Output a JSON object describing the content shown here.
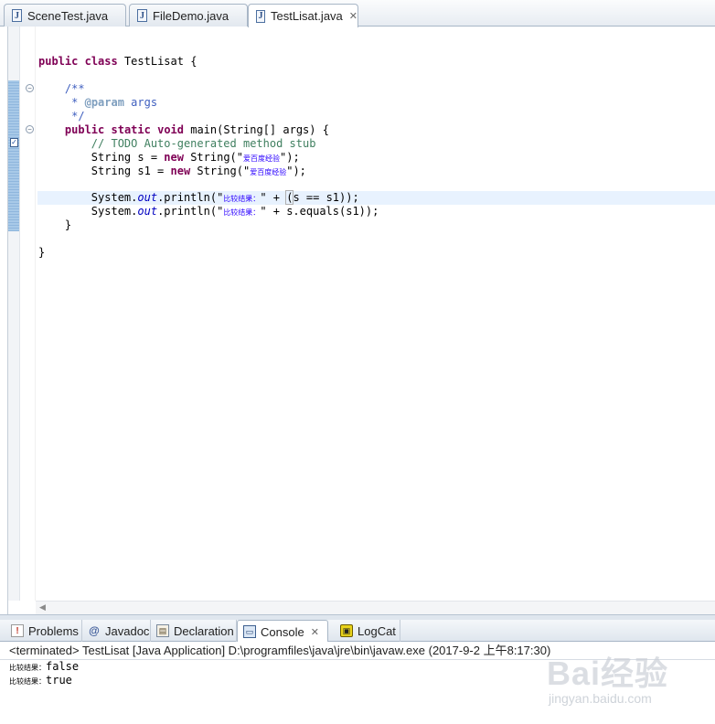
{
  "editor_tabs": [
    {
      "label": "SceneTest.java",
      "icon": "java-file-icon"
    },
    {
      "label": "FileDemo.java",
      "icon": "java-file-icon"
    },
    {
      "label": "TestLisat.java",
      "icon": "java-file-icon",
      "active": true,
      "close": "✕"
    }
  ],
  "code": {
    "l1_kw1": "public",
    "l1_kw2": "class",
    "l1_rest": "TestLisat {",
    "l2": "/**",
    "l3_star": " * ",
    "l3_tag": "@param",
    "l3_rest": " args",
    "l4": " */",
    "l5_kw1": "public",
    "l5_kw2": "static",
    "l5_kw3": "void",
    "l5_rest": "main(String[] args) {",
    "l6": "// TODO Auto-generated method stub",
    "l7_a": "String s = ",
    "l7_kw": "new",
    "l7_b": " String(\"",
    "l7_str": "爱百度经验",
    "l7_c": "\");",
    "l8_a": "String s1 = ",
    "l8_kw": "new",
    "l8_b": " String(\"",
    "l8_str": "爱百度经验",
    "l8_c": "\");",
    "l9_a": "System.",
    "l9_out": "out",
    "l9_b": ".println(\"",
    "l9_str": "比较结果：",
    "l9_c": "\" + ",
    "l9_box": "(",
    "l9_d": "s == s1));",
    "l10_a": "System.",
    "l10_out": "out",
    "l10_b": ".println(\"",
    "l10_str": "比较结果：",
    "l10_c": "\" + s.equals(s1));",
    "l11": "}",
    "l12": "}"
  },
  "view_tabs": [
    {
      "label": "Problems",
      "icon": "problems-icon"
    },
    {
      "label": "Javadoc",
      "icon": "javadoc-icon"
    },
    {
      "label": "Declaration",
      "icon": "declaration-icon"
    },
    {
      "label": "Console",
      "icon": "console-icon",
      "active": true,
      "close": "✕"
    },
    {
      "label": "LogCat",
      "icon": "logcat-icon"
    }
  ],
  "console": {
    "description": "<terminated> TestLisat [Java Application] D:\\programfiles\\java\\jre\\bin\\javaw.exe (2017-9-2 上午8:17:30)",
    "out1_label": "比较结果：",
    "out1_value": "false",
    "out2_label": "比较结果：",
    "out2_value": "true"
  },
  "watermark": {
    "main": "Bai经验",
    "sub": "jingyan.baidu.com"
  }
}
